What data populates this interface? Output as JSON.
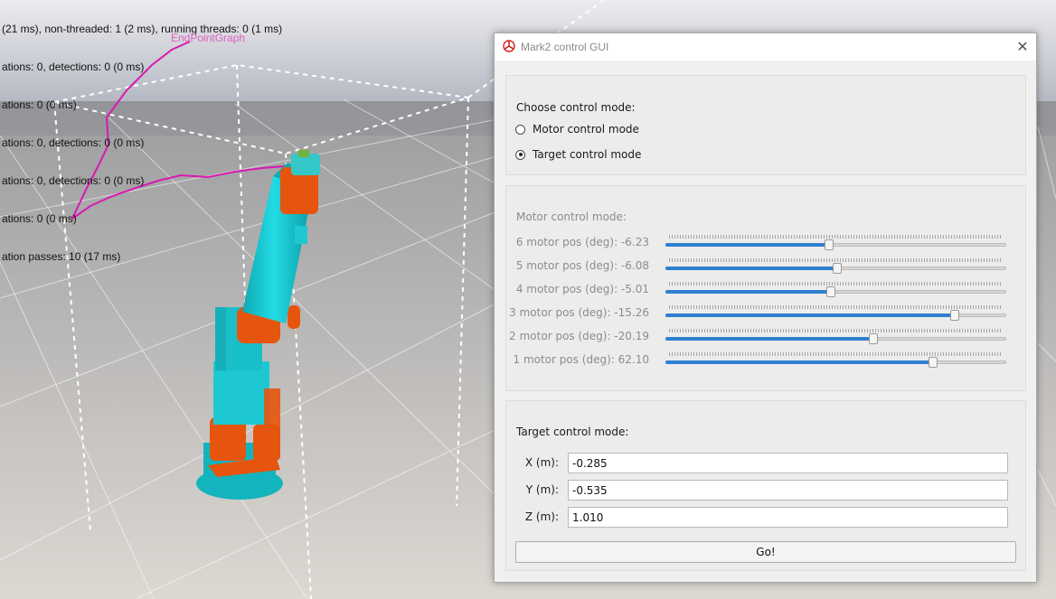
{
  "scene": {
    "stats_lines": [
      "(21 ms), non-threaded: 1 (2 ms), running threads: 0 (1 ms)",
      "ations: 0, detections: 0 (0 ms)",
      "ations: 0 (0 ms)",
      "ations: 0, detections: 0 (0 ms)",
      "ations: 0, detections: 0 (0 ms)",
      "ations: 0 (0 ms)",
      "ation passes: 10 (17 ms)"
    ],
    "graph_label": "EndPointGraph",
    "graph_color": "#d81ab0",
    "robot_color": "#1ec8d2",
    "joint_color": "#e6550d"
  },
  "dialog": {
    "title": "Mark2 control GUI",
    "close_symbol": "✕",
    "mode_group": {
      "title": "Choose control mode:",
      "options": [
        {
          "label": "Motor control mode",
          "checked": false
        },
        {
          "label": "Target control mode",
          "checked": true
        }
      ]
    },
    "motor_group": {
      "title": "Motor control mode:",
      "enabled": false,
      "sliders": [
        {
          "label": "6 motor pos (deg): -6.23",
          "level": 0.48
        },
        {
          "label": "5 motor pos (deg): -6.08",
          "level": 0.505
        },
        {
          "label": "4 motor pos (deg): -5.01",
          "level": 0.485
        },
        {
          "label": "3 motor pos (deg): -15.26",
          "level": 0.85
        },
        {
          "label": "2 motor pos (deg): -20.19",
          "level": 0.61
        },
        {
          "label": "1 motor pos (deg): 62.10",
          "level": 0.785
        }
      ]
    },
    "target_group": {
      "title": "Target control mode:",
      "fields": [
        {
          "label": "X (m):",
          "value": "-0.285"
        },
        {
          "label": "Y (m):",
          "value": "-0.535"
        },
        {
          "label": "Z (m):",
          "value": "1.010"
        }
      ],
      "go_label": "Go!"
    }
  }
}
